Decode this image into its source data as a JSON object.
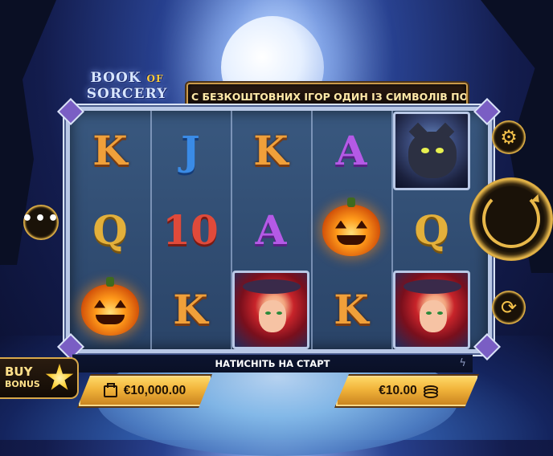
{
  "game": {
    "logo_line1": "BOOK",
    "logo_of": "OF",
    "logo_line2": "SORCERY"
  },
  "ticker": {
    "text": "С БЕЗКОШТОВНИХ ІГОР ОДИН ІЗ СИМВОЛІВ ПОШИР"
  },
  "reels": [
    [
      "K",
      "Q",
      "pumpkin"
    ],
    [
      "J",
      "10",
      "K"
    ],
    [
      "K",
      "A",
      "witch"
    ],
    [
      "A",
      "pumpkin",
      "K"
    ],
    [
      "cat",
      "Q",
      "witch"
    ]
  ],
  "status": {
    "text": "НАТИСНІТЬ НА СТАРТ"
  },
  "balance": {
    "value": "€10,000.00"
  },
  "bet": {
    "value": "€10.00"
  },
  "buy_bonus": {
    "line1": "BUY",
    "line2": "BONUS"
  },
  "icons": {
    "menu": "more-dots-icon",
    "settings": "gear-icon",
    "spin": "spin-arrow-icon",
    "autoplay": "autoplay-icon",
    "turbo": "lightning-icon",
    "wallet": "wallet-icon",
    "coins": "coins-icon",
    "star": "star-icon"
  },
  "colors": {
    "gold": "#e8b84a",
    "panel_gold": "#f1b33a",
    "night_blue": "#131c4d"
  }
}
